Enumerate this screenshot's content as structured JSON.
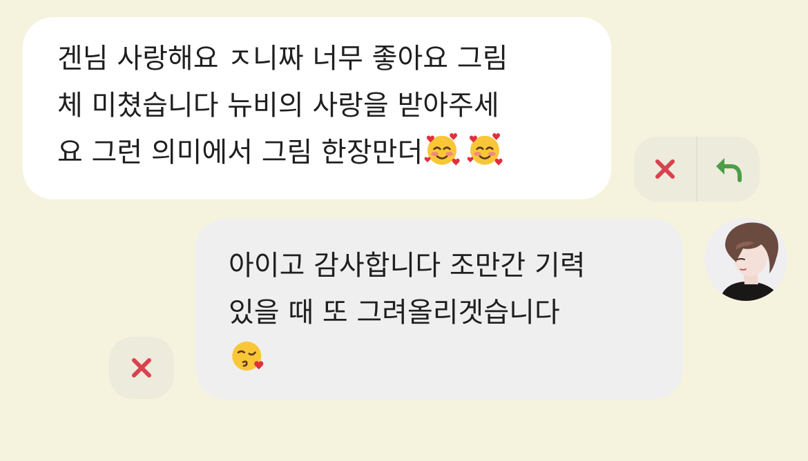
{
  "incoming_message": {
    "lines": [
      "겐님 사랑해요 ㅈ니짜 너무 좋아요 그림",
      "체 미쳤습니다 뉴비의 사랑을 받아주세",
      "요 그런 의미에서 그림 한장만더"
    ],
    "emojis": [
      "smiling-face-with-hearts",
      "smiling-face-with-hearts"
    ]
  },
  "outgoing_message": {
    "lines": [
      "아이고 감사합니다 조만간 기력",
      "있을 때 또 그려올리겟습니다"
    ],
    "emojis": [
      "face-blowing-a-kiss"
    ]
  },
  "actions": {
    "incoming": [
      "close-icon",
      "reply-icon"
    ],
    "outgoing": [
      "close-icon"
    ]
  },
  "colors": {
    "background": "#f5f3de",
    "incoming_bubble": "#ffffff",
    "outgoing_bubble": "#efefef",
    "close_red": "#d9424f",
    "reply_green": "#4e9d47"
  }
}
